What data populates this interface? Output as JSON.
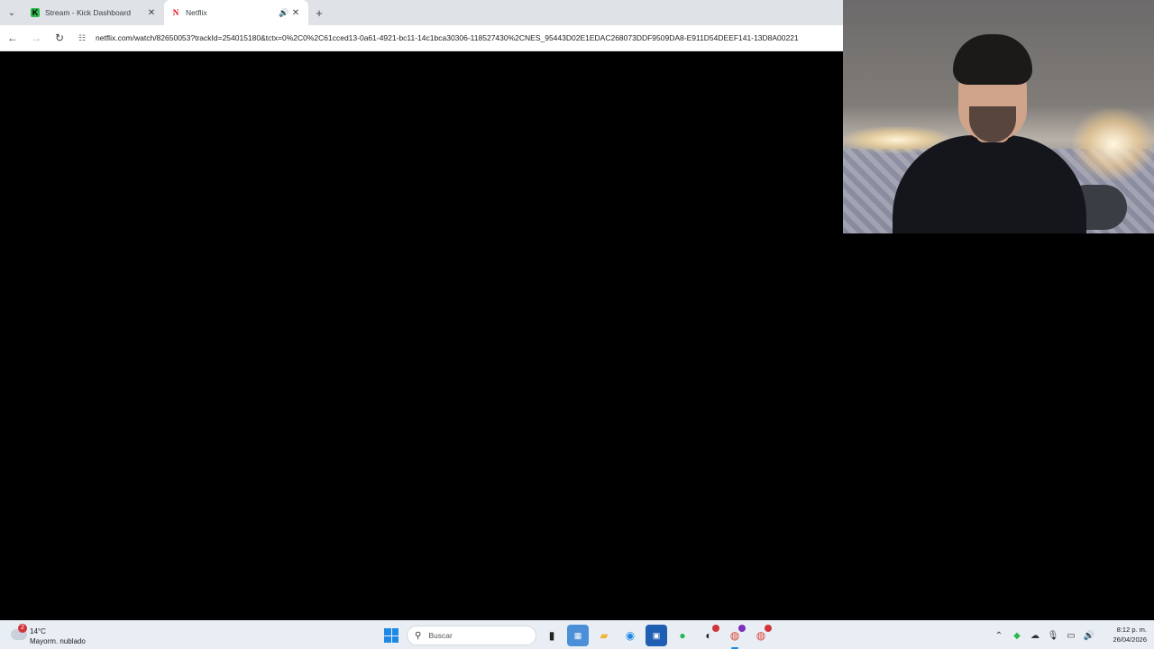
{
  "browser": {
    "tabs": [
      {
        "title": "Stream - Kick Dashboard",
        "favicon": "kick-icon",
        "active": false
      },
      {
        "title": "Netflix",
        "favicon": "netflix-icon",
        "active": true,
        "audio": true
      }
    ],
    "url": "netflix.com/watch/82650053?trackId=254015180&tctx=0%2C0%2C61cced13-0a61-4921-bc11-14c1bca30306-118527430%2CNES_95443D02E1EDAC268073DDF9509DA8-E911D54DEEF141-13D8A00221"
  },
  "taskbar": {
    "weather": {
      "temp": "14°C",
      "condition": "Mayorm. nublado",
      "badge": "2"
    },
    "search_placeholder": "Buscar",
    "clock": {
      "time": "8:12 p. m.",
      "date": "26/04/2026"
    }
  },
  "colors": {
    "accent": "#1e88e5",
    "netflix_red": "#e50914",
    "kick_green": "#2db84d",
    "spotify_green": "#1db954"
  }
}
